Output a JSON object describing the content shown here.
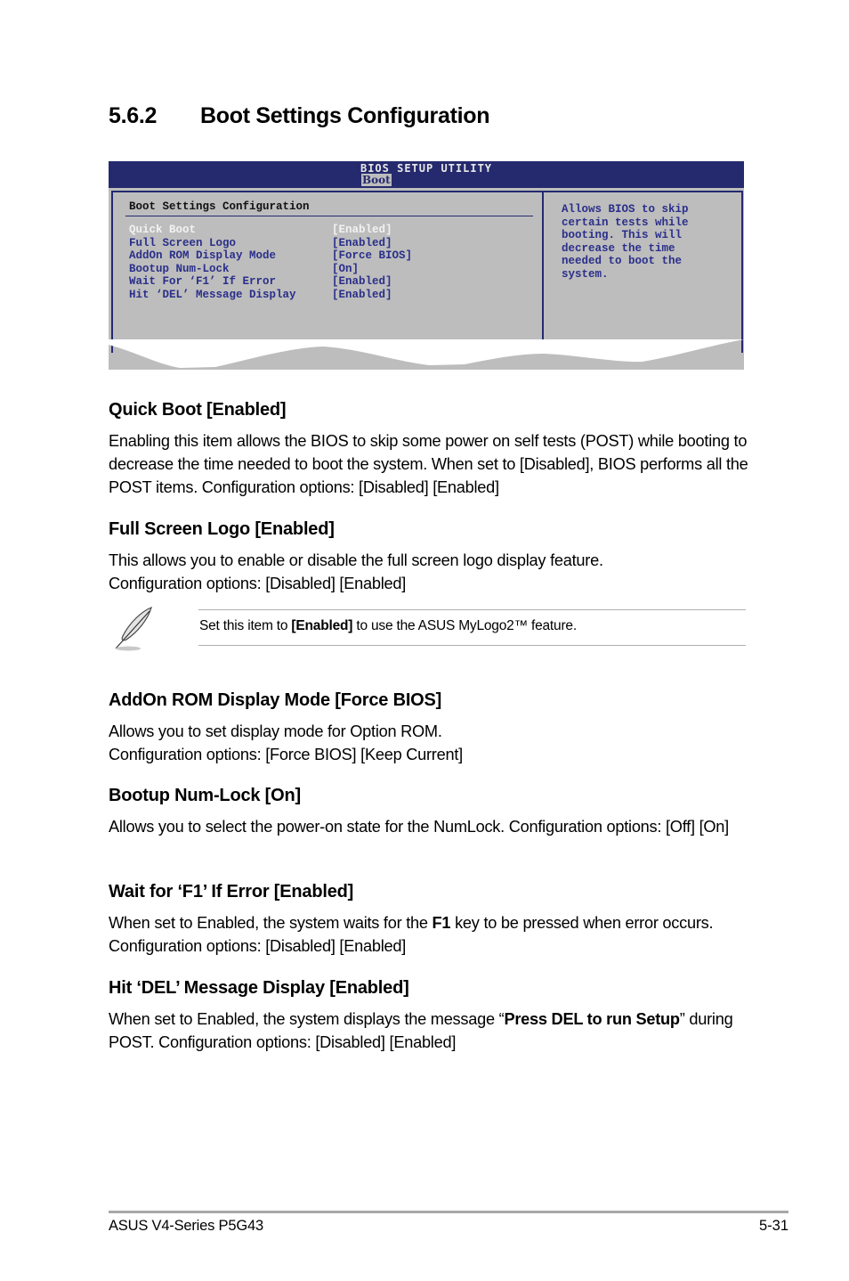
{
  "section": {
    "number": "5.6.2",
    "title": "Boot Settings Configuration"
  },
  "bios": {
    "utility_title": "BIOS SETUP UTILITY",
    "active_tab": "Boot",
    "panel_title": "Boot Settings Configuration",
    "options": [
      {
        "label": "Quick Boot",
        "value": "[Enabled]",
        "selected": true
      },
      {
        "label": "Full Screen Logo",
        "value": "[Enabled]",
        "selected": false
      },
      {
        "label": "AddOn ROM Display Mode",
        "value": "[Force BIOS]",
        "selected": false
      },
      {
        "label": "Bootup Num-Lock",
        "value": "[On]",
        "selected": false
      },
      {
        "label": "Wait For ‘F1’ If Error",
        "value": "[Enabled]",
        "selected": false
      },
      {
        "label": "Hit ‘DEL’ Message Display",
        "value": "[Enabled]",
        "selected": false
      }
    ],
    "help_text": "Allows BIOS to skip\ncertain tests while\nbooting. This will\ndecrease the time\nneeded to boot the\nsystem.",
    "colors": {
      "header_bg": "#252a6e",
      "panel_bg": "#bdbdbd",
      "option_text": "#2a2f8a",
      "selected_text": "#f2f2f2"
    }
  },
  "items": [
    {
      "heading": "Quick Boot [Enabled]",
      "body": "Enabling this item allows the BIOS to skip some power on self tests (POST) while booting to decrease the time needed to boot the system. When set to [Disabled], BIOS performs all the POST items. Configuration options: [Disabled] [Enabled]"
    },
    {
      "heading": "Full Screen Logo [Enabled]",
      "body": "This allows you to enable or disable the full screen logo display feature. Configuration options: [Disabled] [Enabled]"
    },
    {
      "heading": "AddOn ROM Display Mode [Force BIOS]",
      "body_line1": "Allows you to set display mode for Option ROM.",
      "body_line2": "Configuration options: [Force BIOS] [Keep Current]"
    },
    {
      "heading": "Bootup Num-Lock [On]",
      "body": "Allows you to select the power-on state for the NumLock. Configuration options: [Off] [On]"
    },
    {
      "heading": "Wait for ‘F1’ If Error [Enabled]",
      "body_pre": "When set to Enabled, the system waits for the ",
      "body_bold": "F1",
      "body_post": " key to be pressed when error occurs. Configuration options: [Disabled] [Enabled]"
    },
    {
      "heading": "Hit ‘DEL’ Message Display [Enabled]",
      "body_pre": "When set to Enabled, the system displays the message “",
      "body_bold": "Press DEL to run Setup",
      "body_post": "” during POST. Configuration options: [Disabled] [Enabled]"
    }
  ],
  "note": {
    "icon": "feather-pen-icon",
    "text_pre": "Set this item to ",
    "text_bold": "[Enabled]",
    "text_post": " to use the ASUS MyLogo2™ feature."
  },
  "footer": {
    "left": "ASUS V4-Series P5G43",
    "right": "5-31"
  }
}
